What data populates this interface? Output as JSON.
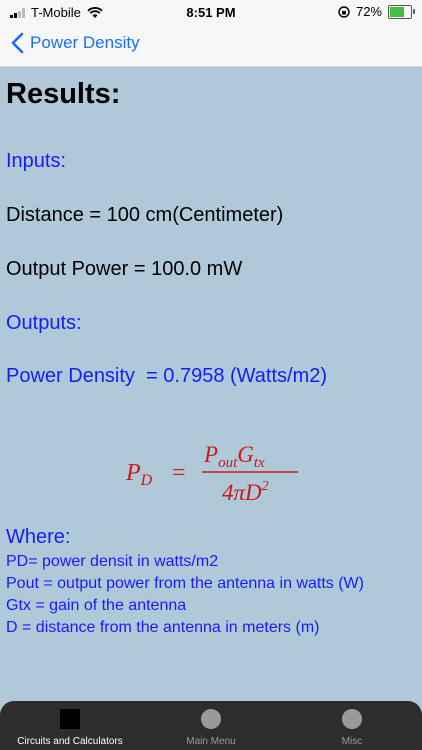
{
  "status": {
    "carrier": "T-Mobile",
    "time": "8:51 PM",
    "battery": "72%"
  },
  "nav": {
    "back_label": "Power Density"
  },
  "results": {
    "title": "Results:",
    "inputs_label": "Inputs:",
    "distance_line": "Distance = 100 cm(Centimeter)",
    "power_line": "Output Power = 100.0 mW",
    "outputs_label": "Outputs:",
    "density_line": "Power Density  = 0.7958 (Watts/m2)"
  },
  "formula": {
    "lhs": "P",
    "lhs_sub": "D",
    "num": "P",
    "num_sub1": "out",
    "num_g": "G",
    "num_sub2": "tx",
    "den": "4πD",
    "den_sup": "2"
  },
  "where": {
    "heading": "Where:",
    "lines": [
      "PD= power densit in watts/m2",
      "Pout = output power from the antenna in watts (W)",
      "Gtx = gain of the antenna",
      "D = distance from the antenna in meters (m)"
    ]
  },
  "tabs": [
    {
      "label": "Circuits and Calculators"
    },
    {
      "label": "Main Menu"
    },
    {
      "label": "Misc"
    }
  ]
}
